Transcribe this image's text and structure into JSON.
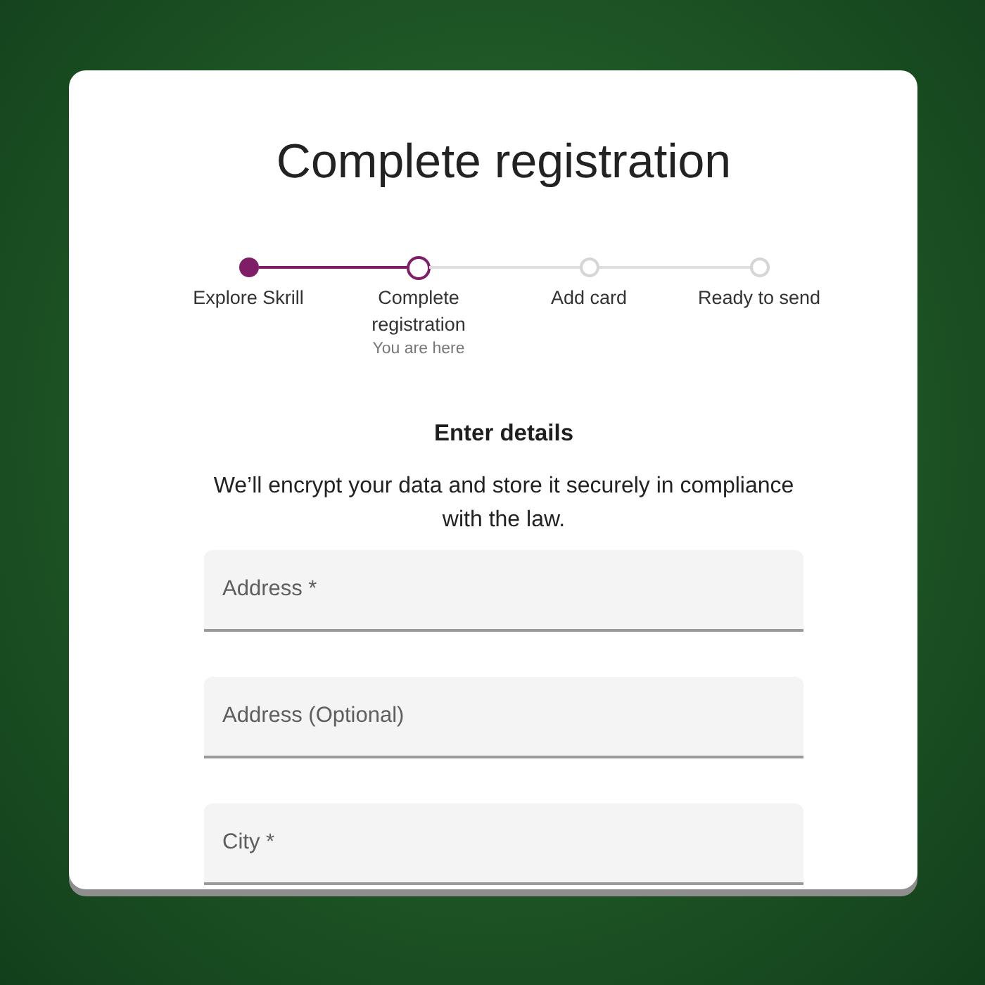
{
  "title": "Complete registration",
  "stepper": {
    "steps": [
      {
        "label": "Explore Skrill",
        "completed": true,
        "selected": false
      },
      {
        "label": "Complete registration",
        "completed": false,
        "selected": true,
        "note": "You are here"
      },
      {
        "label": "Add card",
        "completed": false,
        "selected": false
      },
      {
        "label": "Ready to send",
        "completed": false,
        "selected": false
      }
    ]
  },
  "section": {
    "heading": "Enter details",
    "description": "We’ll encrypt your data and store it securely in compliance with the law."
  },
  "fields": [
    {
      "placeholder": "Address *"
    },
    {
      "placeholder": "Address (Optional)"
    },
    {
      "placeholder": "City *"
    }
  ]
}
